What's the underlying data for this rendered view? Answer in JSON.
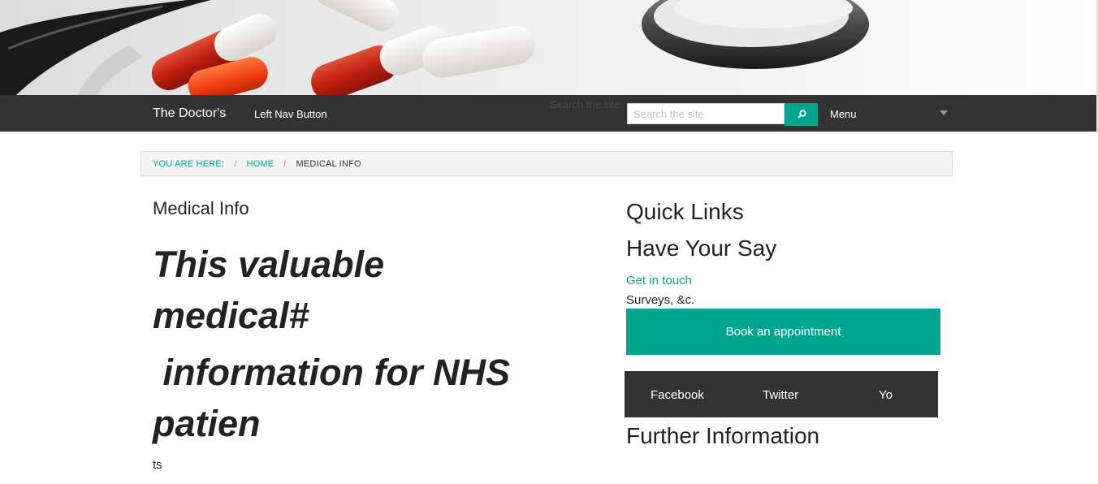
{
  "header": {
    "brand": "The Doctor's",
    "left_nav": "Left Nav Button",
    "search_label": "Search the site",
    "search_placeholder": "Search the site",
    "search_icon": "search-icon",
    "menu_label": "Menu"
  },
  "breadcrumb": {
    "here": "YOU ARE HERE:",
    "sep": "/",
    "home": "HOME",
    "current": "MEDICAL INFO"
  },
  "main": {
    "title": "Medical Info",
    "lines": [
      "This valuable",
      "medical#",
      " information for NHS",
      "patien"
    ],
    "tail": "ts"
  },
  "sidebar": {
    "quick_links": "Quick Links",
    "have_your_say": "Have Your Say",
    "get_in_touch": "Get in touch",
    "surveys": "Surveys, &c.",
    "book": "Book an appointment",
    "social": [
      "Facebook",
      "Twitter",
      "Yo"
    ],
    "further": "Further Information"
  },
  "colors": {
    "accent": "#00a58d",
    "nav": "#333333"
  }
}
